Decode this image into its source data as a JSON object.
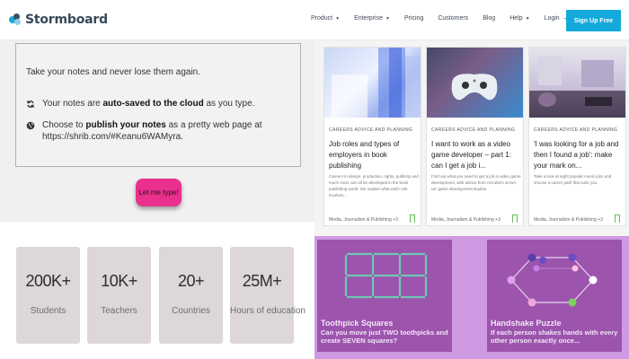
{
  "header": {
    "brand": "Stormboard",
    "nav": [
      {
        "label": "Product",
        "caret": true
      },
      {
        "label": "Enterprise",
        "caret": true
      },
      {
        "label": "Pricing",
        "caret": false
      },
      {
        "label": "Customers",
        "caret": false
      },
      {
        "label": "Blog",
        "caret": false
      },
      {
        "label": "Help",
        "caret": true
      },
      {
        "label": "Login →",
        "caret": false
      }
    ],
    "signup_label": "Sign Up Free"
  },
  "info": {
    "title": "Take your notes and never lose them again.",
    "row1_pre": "Your notes are ",
    "row1_bold": "auto-saved to the cloud",
    "row1_post": " as you type.",
    "row2_pre": "Choose to ",
    "row2_bold": "publish your notes",
    "row2_post": " as a pretty web page at",
    "row2_line2": "https://shrib.com/#Keanu6WAMyra.",
    "button": "Let me type!"
  },
  "stats": [
    {
      "value": "200K+",
      "label": "Students"
    },
    {
      "value": "10K+",
      "label": "Teachers"
    },
    {
      "value": "20+",
      "label": "Countries"
    },
    {
      "value": "25M+",
      "label": "Hours of education"
    }
  ],
  "articles": [
    {
      "category": "CAREERS ADVICE AND PLANNING",
      "title": "Job roles and types of employers in book publishing",
      "desc": "Careers in design, production, rights, publicity and much more can all be developed in the book publishing world. We explain what each role involves...",
      "foot": "Media, Journalism & Publishing +3"
    },
    {
      "category": "CAREERS ADVICE AND PLANNING",
      "title": "I want to work as a video game developer – part 1: can I get a job i...",
      "desc": "Find out what you need to get a job in video game development, with advice from recruiters at two UK game development studios.",
      "foot": "Media, Journalism & Publishing +3"
    },
    {
      "category": "CAREERS ADVICE AND PLANNING",
      "title": "'I was looking for a job and then I found a job': make your mark on...",
      "desc": "Take a look at eight popular music jobs and choose a career path that suits you.",
      "foot": "Media, Journalism & Publishing +3"
    }
  ],
  "puzzles": [
    {
      "title": "Toothpick Squares",
      "desc": "Can you move just TWO toothpicks and create SEVEN squares?"
    },
    {
      "title": "Handshake Puzzle",
      "desc": "If each person shakes hands with every other person exactly once..."
    }
  ],
  "colors": {
    "accent": "#14a9db",
    "pink_button": "#e8308c",
    "puzzle_bg": "#9c54ad",
    "puzzle_border": "#cf9ae2",
    "bookmark": "#66bb55"
  }
}
